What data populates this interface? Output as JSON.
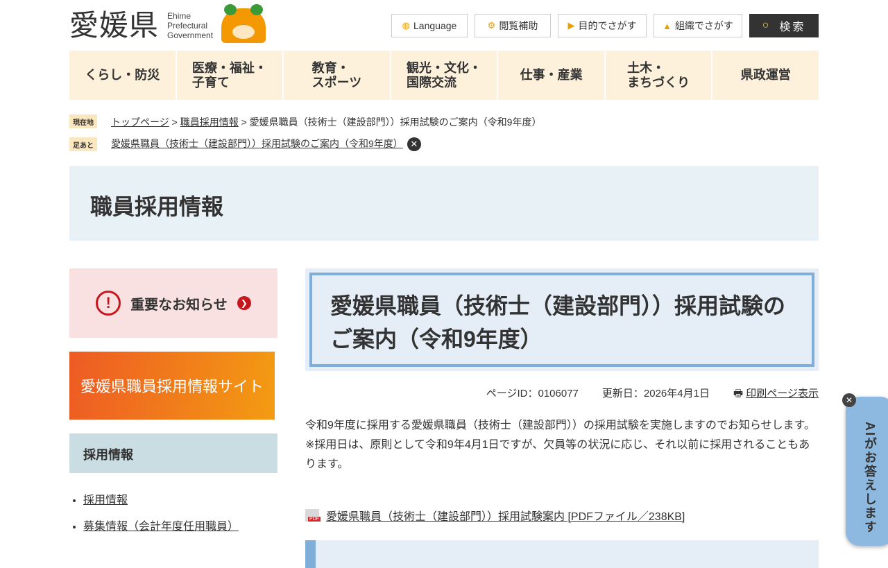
{
  "header": {
    "logo_kanji": "愛媛県",
    "logo_en": [
      "Ehime",
      "Prefectural",
      "Government"
    ],
    "buttons": [
      {
        "label": "Language",
        "icon": "globe-icon"
      },
      {
        "label": "閲覧補助",
        "icon": "gear-icon"
      },
      {
        "label": "目的でさがす",
        "icon": "flag-icon"
      },
      {
        "label": "組織でさがす",
        "icon": "org-chart-icon"
      }
    ],
    "search_label": "検索"
  },
  "nav": [
    "くらし・防災",
    "医療・福祉・\n子育て",
    "教育・\nスポーツ",
    "観光・文化・\n国際交流",
    "仕事・産業",
    "土木・\nまちづくり",
    "県政運営"
  ],
  "breadcrumb": {
    "tag": "現在地",
    "items": [
      "トップページ",
      "職員採用情報"
    ],
    "current": "愛媛県職員（技術士（建設部門））採用試験のご案内（令和9年度）",
    "sep": ">"
  },
  "footprint": {
    "tag": "足あと",
    "item": "愛媛県職員（技術士（建設部門））採用試験のご案内（令和9年度）"
  },
  "section_title": "職員採用情報",
  "sidebar": {
    "notice": "重要なお知らせ",
    "recruit_banner": "愛媛県職員採用情報サイト",
    "heading": "採用情報",
    "links": [
      "採用情報",
      "募集情報（会計年度任用職員）"
    ]
  },
  "main": {
    "title": "愛媛県職員（技術士（建設部門））採用試験のご案内（令和9年度）",
    "page_id": "ページID：0106077",
    "updated": "更新日：2026年4月1日",
    "print": "印刷ページ表示",
    "para1": "令和9年度に採用する愛媛県職員（技術士（建設部門））の採用試験を実施しますのでお知らせします。",
    "para2": "※採用日は、原則として令和9年4月1日ですが、欠員等の状況に応じ、それ以前に採用されることもあります。",
    "pdf_link": "愛媛県職員（技術士（建設部門））採用試験案内 [PDFファイル／238KB]",
    "pdf_badge": "PDF"
  },
  "ai_button": "AIがお答えします"
}
